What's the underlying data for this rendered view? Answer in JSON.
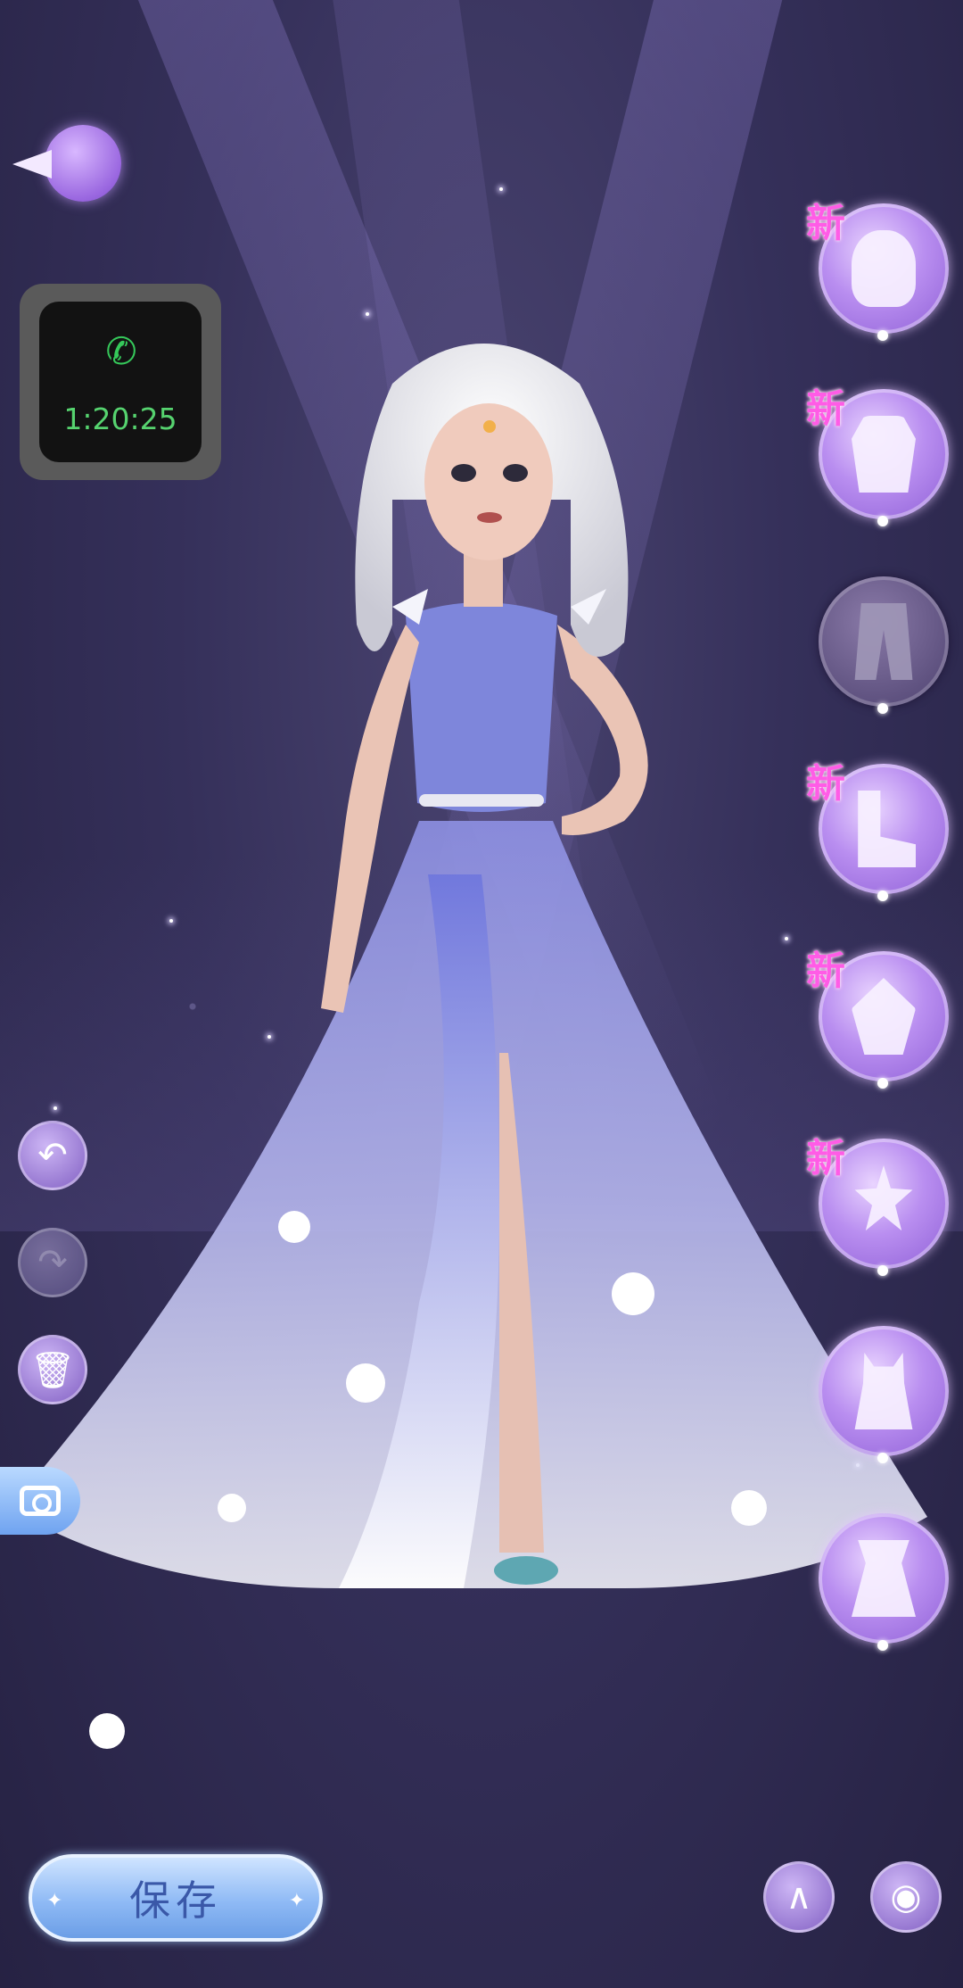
{
  "call": {
    "time": "1:20:25"
  },
  "categories": [
    {
      "id": "hair",
      "new_label": "新",
      "is_new": true,
      "active": false
    },
    {
      "id": "top",
      "new_label": "新",
      "is_new": true,
      "active": false
    },
    {
      "id": "bottom",
      "new_label": "",
      "is_new": false,
      "active": true
    },
    {
      "id": "shoes",
      "new_label": "新",
      "is_new": true,
      "active": false
    },
    {
      "id": "accessories",
      "new_label": "新",
      "is_new": true,
      "active": false
    },
    {
      "id": "handheld",
      "new_label": "新",
      "is_new": true,
      "active": false
    },
    {
      "id": "pet",
      "new_label": "",
      "is_new": false,
      "active": false
    },
    {
      "id": "outfit",
      "new_label": "",
      "is_new": false,
      "active": false
    }
  ],
  "bottom_bar": {
    "save_label": "保存"
  },
  "colors": {
    "accent_purple": "#b98ef0",
    "new_tag": "#ff5ce6",
    "save_text": "#3a58a8",
    "call_green": "#56d36f"
  }
}
